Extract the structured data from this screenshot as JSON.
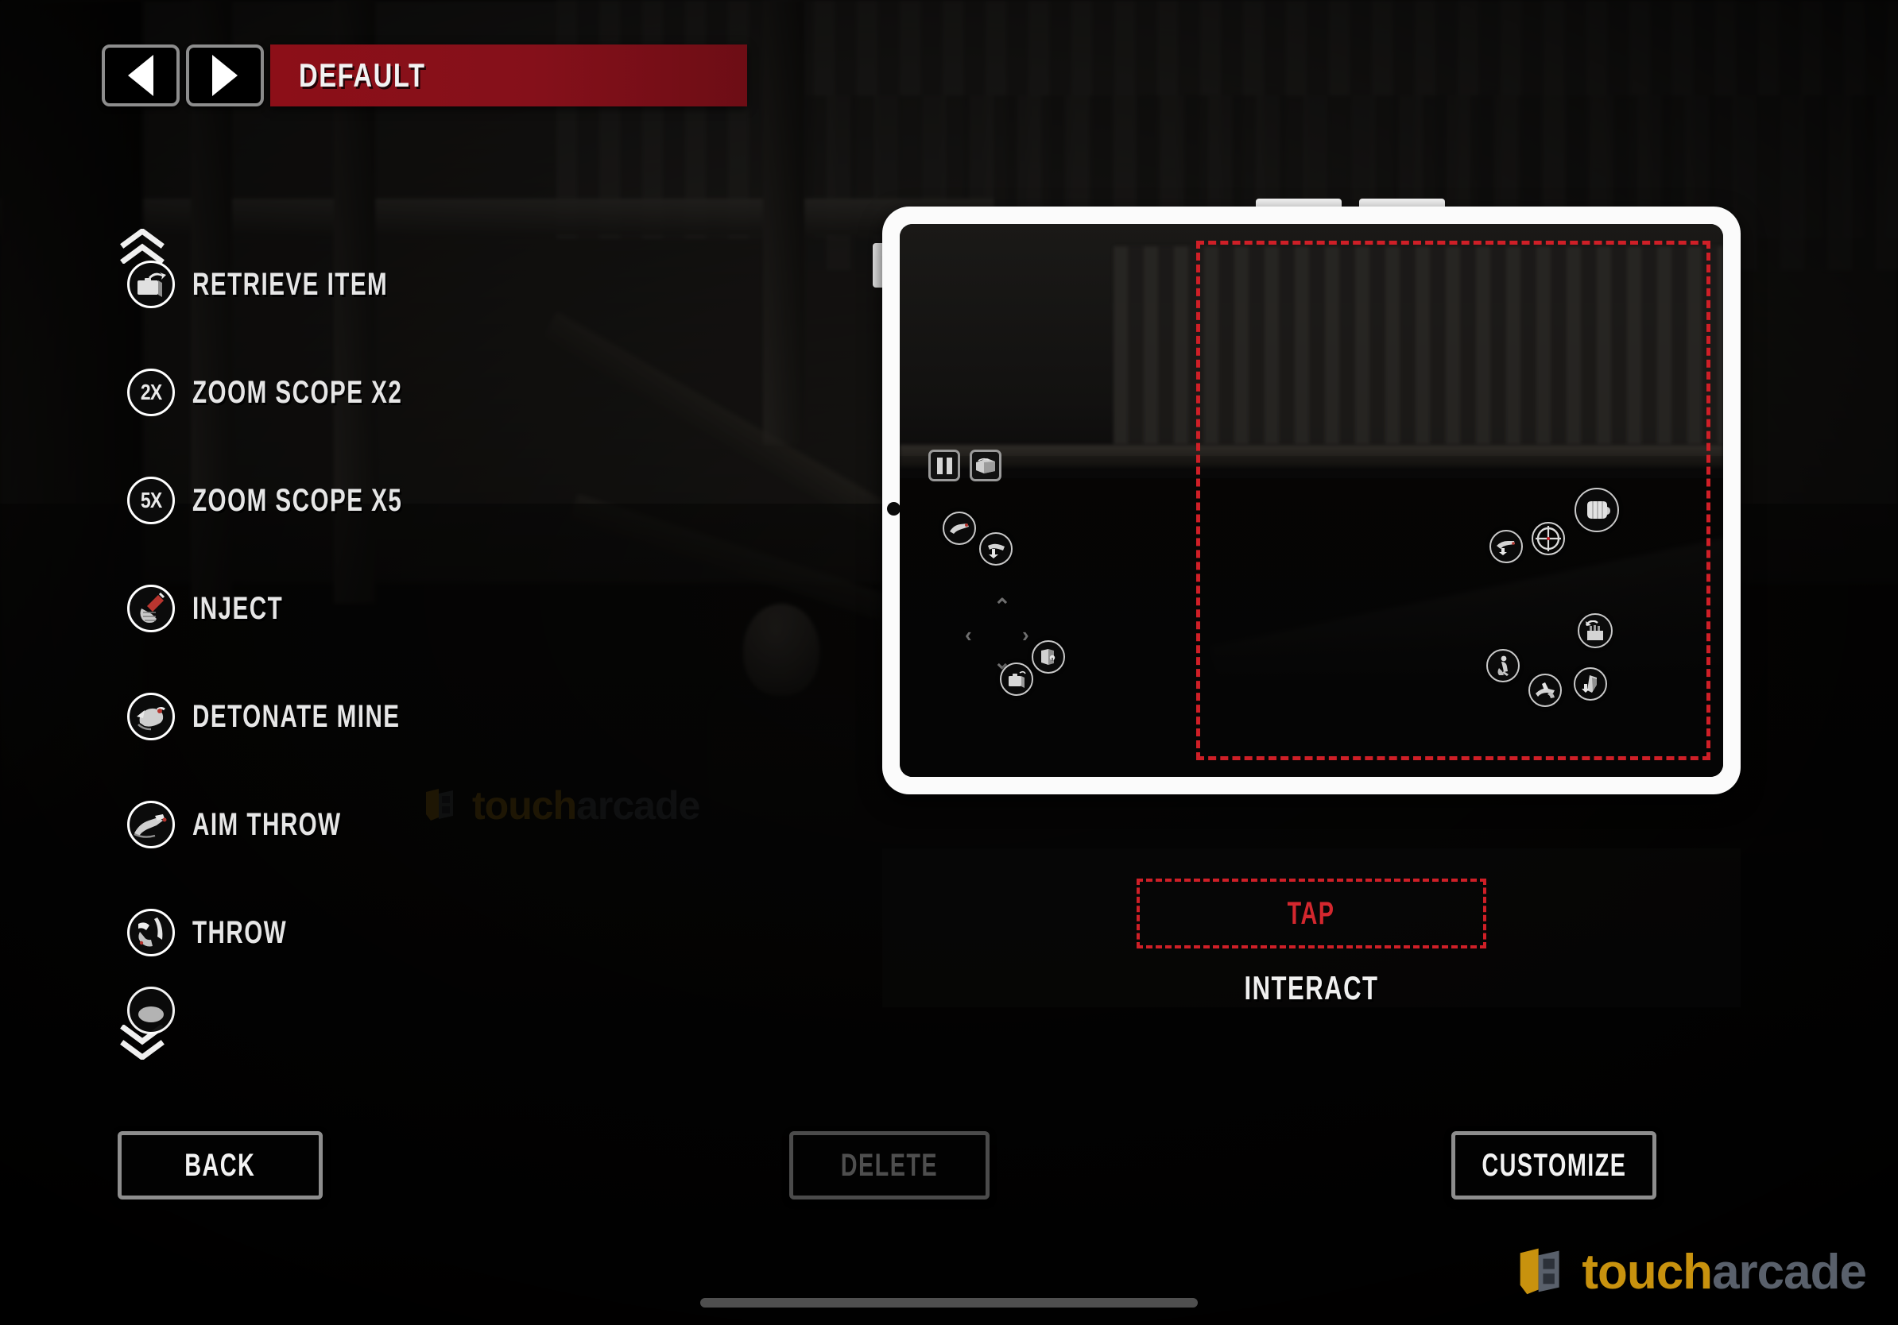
{
  "header": {
    "prev_button": "prev-profile",
    "next_button": "next-profile",
    "profile_name": "DEFAULT"
  },
  "action_list": {
    "scroll_up": "scroll-up",
    "scroll_down": "scroll-down",
    "items": [
      {
        "label": "RETRIEVE ITEM",
        "icon": "briefcase-retrieve-icon"
      },
      {
        "label": "ZOOM SCOPE X2",
        "icon": "zoom-2x-icon",
        "badge": "2X"
      },
      {
        "label": "ZOOM SCOPE X5",
        "icon": "zoom-5x-icon",
        "badge": "5X"
      },
      {
        "label": "INJECT",
        "icon": "syringe-icon"
      },
      {
        "label": "DETONATE MINE",
        "icon": "detonator-icon"
      },
      {
        "label": "AIM THROW",
        "icon": "aim-throw-icon"
      },
      {
        "label": "THROW",
        "icon": "throw-icon"
      }
    ]
  },
  "preview": {
    "device": "tablet-preview",
    "hud": {
      "pause_button": "pause-icon",
      "inventory_button": "inventory-briefcase-icon",
      "dpad": {
        "up": "⌃",
        "down": "⌄",
        "left": "‹",
        "right": "›"
      },
      "left_controls": [
        "peek-icon",
        "drop-icon",
        "briefcase-icon",
        "door-lock-icon"
      ],
      "right_controls": [
        "pickup-icon",
        "aim-crosshair-icon",
        "punch-fist-icon",
        "reload-icon",
        "crouch-icon",
        "takedown-icon",
        "weapon-icon"
      ]
    },
    "touch_zone_label": "touch-zone"
  },
  "binding": {
    "gesture": "TAP",
    "action": "INTERACT"
  },
  "footer": {
    "back": "BACK",
    "delete": "DELETE",
    "customize": "CUSTOMIZE"
  },
  "watermark": {
    "touch": "touch",
    "arcade": "arcade"
  },
  "colors": {
    "accent_red": "#8c0f18",
    "dashed_red": "#cf1f27",
    "tap_text_red": "#d3272e",
    "button_border": "#8d8d8d",
    "disabled_text": "#4e4e4e",
    "watermark_gold": "#c8920e",
    "watermark_slate": "#59606b"
  }
}
